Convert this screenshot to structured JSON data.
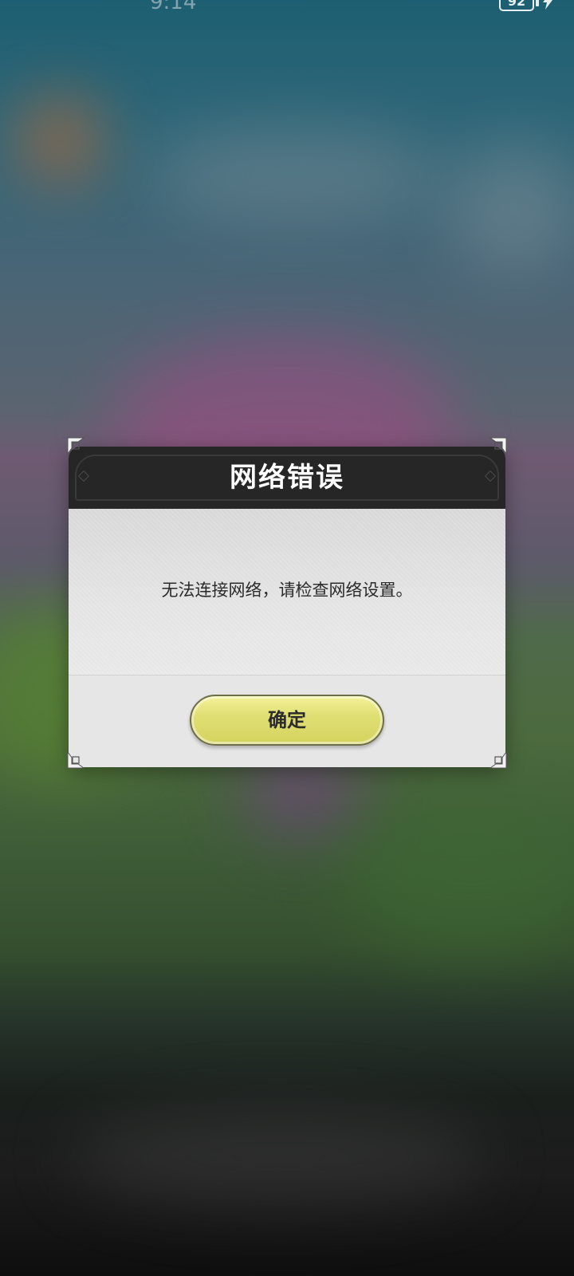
{
  "status_bar": {
    "time": "9:14",
    "battery_level": "92",
    "charging": true
  },
  "dialog": {
    "title": "网络错误",
    "message": "无法连接网络，请检查网络设置。",
    "confirm_label": "确定"
  },
  "colors": {
    "header_bg": "#262626",
    "body_bg": "#e6e6e6",
    "button_yellow": "#e0df74",
    "title_text": "#ffffff"
  },
  "icons": [
    "charging-bolt-icon",
    "corner-ornament-icon",
    "header-diamond-icon"
  ]
}
